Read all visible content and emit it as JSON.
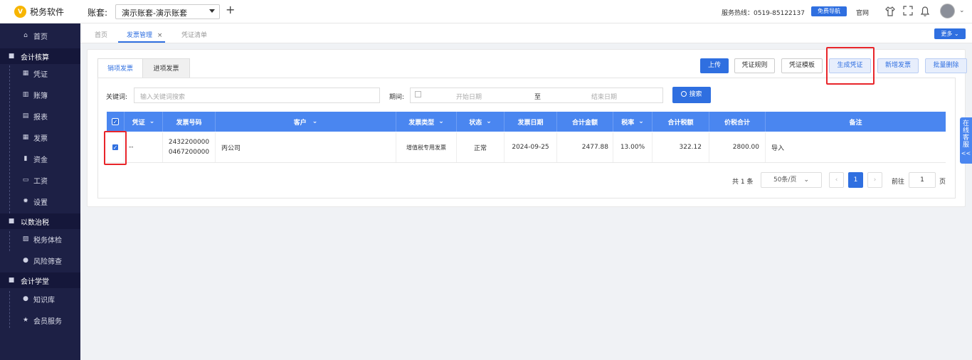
{
  "app": {
    "name": "税务软件",
    "logo_glyph": "V"
  },
  "topbar": {
    "account_label": "账套:",
    "account_value": "演示账套-演示账套",
    "add_icon": "+",
    "hotline": "服务热线：0519-85122137",
    "free_nav": "免费导航",
    "official": "官网"
  },
  "sidebar": {
    "items": [
      {
        "type": "item",
        "label": "首页",
        "icon": "home-icon",
        "glyph": "⌂"
      },
      {
        "type": "section",
        "label": "会计核算",
        "icon": "grid-icon",
        "glyph": "■"
      },
      {
        "type": "item",
        "label": "凭证",
        "icon": "voucher-icon",
        "glyph": "▦"
      },
      {
        "type": "item",
        "label": "账簿",
        "icon": "ledger-icon",
        "glyph": "▥"
      },
      {
        "type": "item",
        "label": "报表",
        "icon": "report-icon",
        "glyph": "▤"
      },
      {
        "type": "item",
        "label": "发票",
        "icon": "invoice-icon",
        "glyph": "▦"
      },
      {
        "type": "item",
        "label": "资金",
        "icon": "fund-icon",
        "glyph": "▮"
      },
      {
        "type": "item",
        "label": "工资",
        "icon": "salary-icon",
        "glyph": "▭"
      },
      {
        "type": "item",
        "label": "设置",
        "icon": "gear-icon",
        "glyph": "✹"
      },
      {
        "type": "section",
        "label": "以数治税",
        "icon": "grid-icon",
        "glyph": "■"
      },
      {
        "type": "item",
        "label": "税务体检",
        "icon": "checkup-icon",
        "glyph": "▨"
      },
      {
        "type": "item",
        "label": "风险筛查",
        "icon": "risk-icon",
        "glyph": "●"
      },
      {
        "type": "section",
        "label": "会计学堂",
        "icon": "grid-icon",
        "glyph": "■"
      },
      {
        "type": "item",
        "label": "知识库",
        "icon": "location-icon",
        "glyph": "●"
      },
      {
        "type": "item",
        "label": "会员服务",
        "icon": "star-icon",
        "glyph": "★"
      }
    ]
  },
  "tabs": {
    "items": [
      {
        "label": "首页"
      },
      {
        "label": "发票管理",
        "close": "×"
      },
      {
        "label": "凭证清单"
      }
    ],
    "more": "更多 ⌄"
  },
  "invoice": {
    "tab_sales": "销项发票",
    "tab_purchase": "进项发票",
    "buttons": {
      "upload": "上传",
      "rules": "凭证规则",
      "template": "凭证模板",
      "generate": "生成凭证",
      "add": "新增发票",
      "batch_delete": "批量删除"
    },
    "filter": {
      "keyword_label": "关键词:",
      "keyword_placeholder": "输入关键词搜索",
      "period_label": "期间:",
      "start_placeholder": "开始日期",
      "to": "至",
      "end_placeholder": "结束日期",
      "search": "搜索"
    },
    "table": {
      "headers": [
        "凭证",
        "发票号码",
        "客户",
        "发票类型",
        "状态",
        "发票日期",
        "合计金额",
        "税率",
        "合计税额",
        "价税合计",
        "备注"
      ],
      "rows": [
        {
          "voucher": "--",
          "number_line1": "2432200000",
          "number_line2": "0467200000",
          "customer": "丙公司",
          "type": "增值税专用发票",
          "status": "正常",
          "date": "2024-09-25",
          "amount": "2477.88",
          "rate": "13.00%",
          "tax": "322.12",
          "total": "2800.00",
          "remark": "导入",
          "checked": true
        }
      ]
    },
    "pagination": {
      "total": "共 1 条",
      "page_size": "50条/页",
      "prev": "‹",
      "current": "1",
      "next": "›",
      "goto_label": "前往",
      "goto_value": "1",
      "goto_unit": "页"
    }
  },
  "float_tab": {
    "text": "在线客服",
    "arrows": "<<"
  },
  "colors": {
    "primary": "#2f6fe0",
    "sidebar": "#1d2045",
    "highlight": "#e8252a",
    "table_header": "#4a86f0"
  }
}
